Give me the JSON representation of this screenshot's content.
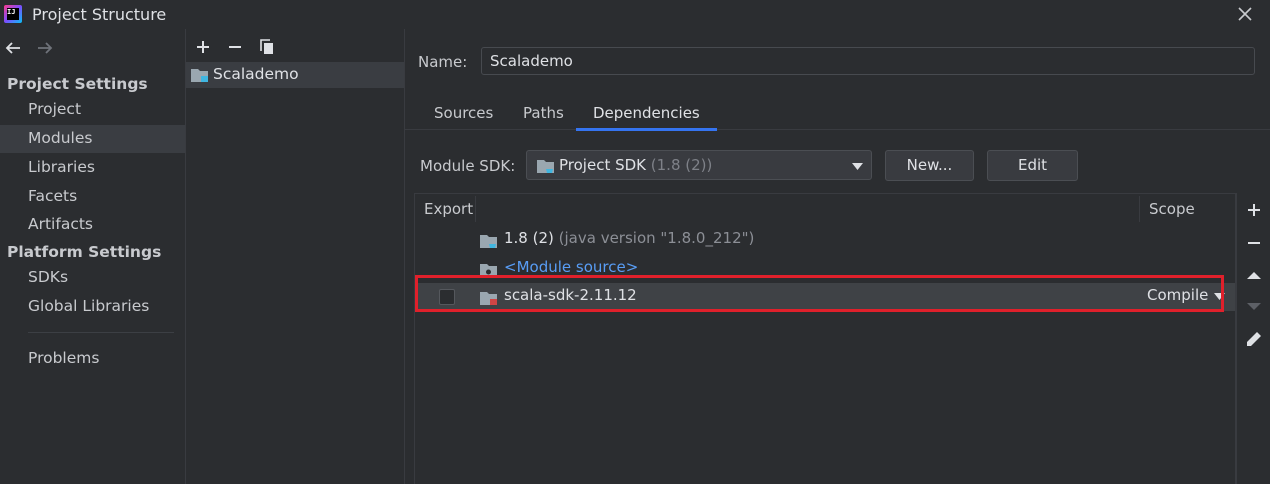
{
  "window": {
    "title": "Project Structure",
    "logo_text": "IJ"
  },
  "nav": {
    "project_settings_header": "Project Settings",
    "project_items": [
      {
        "label": "Project",
        "selected": false
      },
      {
        "label": "Modules",
        "selected": true
      },
      {
        "label": "Libraries",
        "selected": false
      },
      {
        "label": "Facets",
        "selected": false
      },
      {
        "label": "Artifacts",
        "selected": false
      }
    ],
    "platform_settings_header": "Platform Settings",
    "platform_items": [
      {
        "label": "SDKs"
      },
      {
        "label": "Global Libraries"
      }
    ],
    "problems_label": "Problems"
  },
  "modules": {
    "items": [
      {
        "label": "Scalademo",
        "selected": true
      }
    ]
  },
  "module_detail": {
    "name_label": "Name:",
    "name_value": "Scalademo",
    "tabs": [
      {
        "label": "Sources",
        "active": false
      },
      {
        "label": "Paths",
        "active": false
      },
      {
        "label": "Dependencies",
        "active": true
      }
    ],
    "sdk_label": "Module SDK:",
    "sdk_value": "Project SDK",
    "sdk_version": "(1.8 (2))",
    "new_button": "New...",
    "edit_button": "Edit",
    "table": {
      "col_export": "Export",
      "col_scope": "Scope",
      "rows": [
        {
          "name": "1.8 (2)",
          "detail": "(java version \"1.8.0_212\")"
        },
        {
          "name": "<Module source>"
        },
        {
          "name": "scala-sdk-2.11.12",
          "scope": "Compile",
          "exported": false,
          "selected": true
        }
      ]
    }
  },
  "colors": {
    "accent": "#3574f0",
    "highlight": "#e0202b",
    "link": "#589df6",
    "background": "#2b2d30"
  }
}
